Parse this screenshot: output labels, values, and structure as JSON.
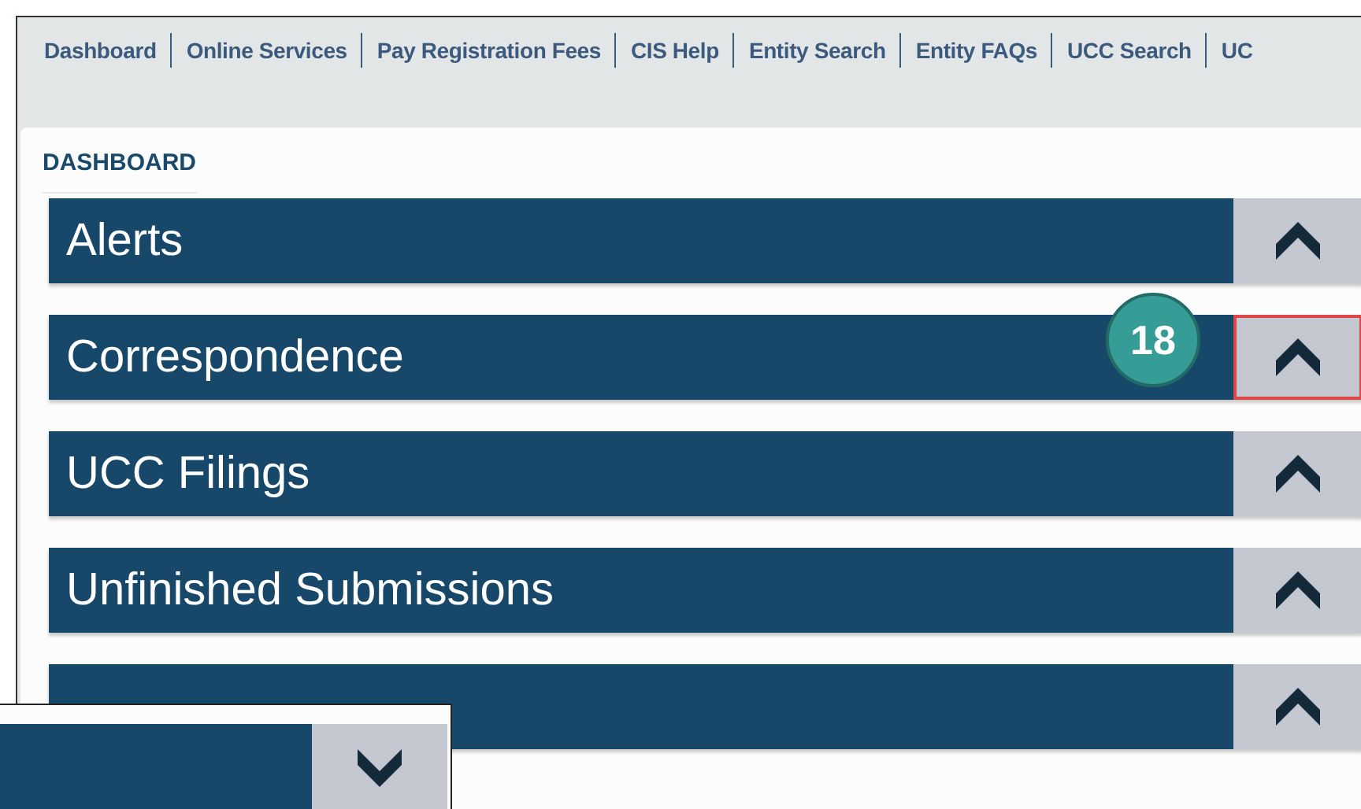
{
  "nav": [
    {
      "label": "Dashboard"
    },
    {
      "label": "Online Services"
    },
    {
      "label": "Pay Registration Fees"
    },
    {
      "label": "CIS Help"
    },
    {
      "label": "Entity Search"
    },
    {
      "label": "Entity FAQs"
    },
    {
      "label": "UCC Search"
    },
    {
      "label": "UC"
    }
  ],
  "section_title": "DASHBOARD",
  "panels": [
    {
      "title": "Alerts",
      "expanded": true,
      "highlighted": false
    },
    {
      "title": "Correspondence",
      "expanded": true,
      "highlighted": true
    },
    {
      "title": "UCC Filings",
      "expanded": true,
      "highlighted": false
    },
    {
      "title": "Unfinished Submissions",
      "expanded": true,
      "highlighted": false
    },
    {
      "expanded": true,
      "highlighted": false
    }
  ],
  "callout": {
    "number": "18"
  },
  "inset": {
    "expanded": false
  }
}
